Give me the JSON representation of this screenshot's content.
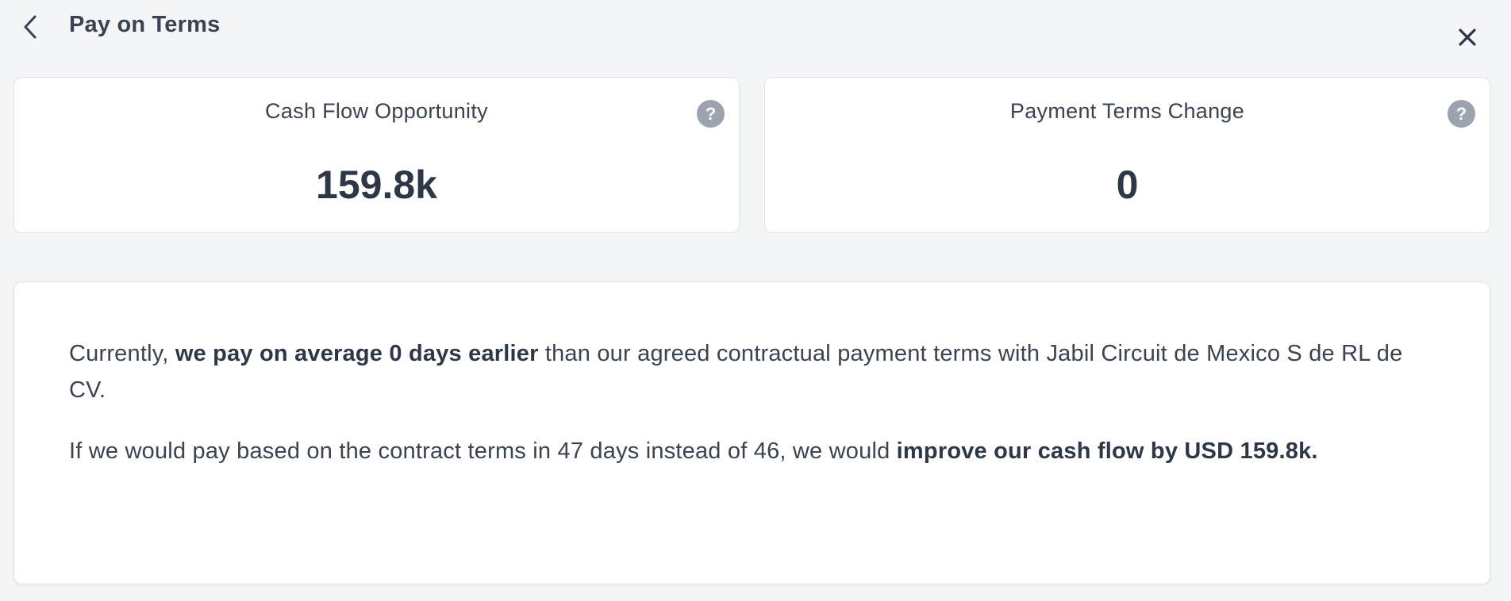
{
  "header": {
    "title": "Pay on Terms",
    "back_icon": "chevron-left-icon",
    "close_icon": "close-icon"
  },
  "kpis": {
    "cash_flow": {
      "title": "Cash Flow Opportunity",
      "value": "159.8k",
      "help_icon": "question-circle-icon",
      "help_glyph": "?"
    },
    "payment_terms": {
      "title": "Payment Terms Change",
      "value": "0",
      "help_icon": "question-circle-icon",
      "help_glyph": "?"
    }
  },
  "info": {
    "para1": {
      "prefix": "Currently, ",
      "bold": "we pay on average 0 days earlier",
      "suffix": " than our agreed contractual payment terms with Jabil Circuit de Mexico S de RL de CV."
    },
    "para2": {
      "prefix": "If we would pay based on the contract terms in 47 days instead of 46, we would ",
      "bold": "improve our cash flow by USD 159.8k.",
      "suffix": ""
    }
  },
  "colors": {
    "background": "#f4f5f7",
    "card": "#ffffff",
    "text": "#2d3748",
    "help_icon": "#9ca3ae"
  }
}
